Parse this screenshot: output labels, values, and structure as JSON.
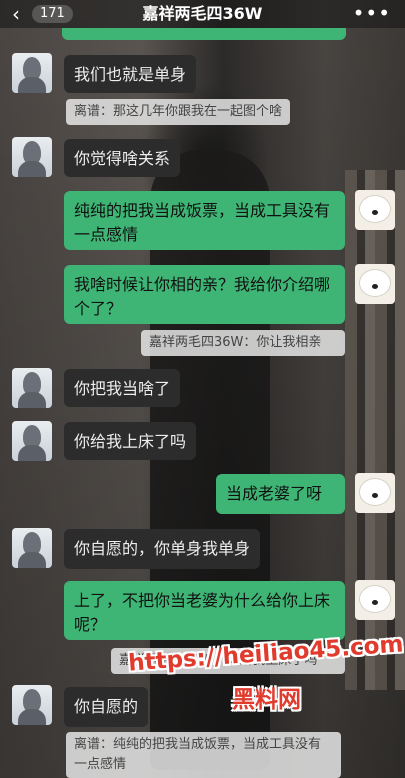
{
  "header": {
    "back_icon": "chevron-left-icon",
    "unread_count": "171",
    "title": "嘉祥两毛四36W",
    "more_icon": "more-dots-icon"
  },
  "colors": {
    "green_bubble": "#3eb575",
    "dark_bubble": "#2c2c2c",
    "quote_bg": "#e6e6e6",
    "watermark": "#e13b2e"
  },
  "messages": [
    {
      "side": "left",
      "text": "我们也就是单身",
      "quote": "离谱：那这几年你跟我在一起图个啥"
    },
    {
      "side": "left",
      "text": "你觉得啥关系"
    },
    {
      "side": "right",
      "text": "纯纯的把我当成饭票，当成工具没有一点感情"
    },
    {
      "side": "right",
      "text": "我啥时候让你相的亲？我给你介绍哪个了？",
      "quote": "嘉祥两毛四36W：你让我相亲"
    },
    {
      "side": "left",
      "text": "你把我当啥了"
    },
    {
      "side": "left",
      "text": "你给我上床了吗"
    },
    {
      "side": "right",
      "text": "当成老婆了呀"
    },
    {
      "side": "left",
      "text": "你自愿的，你单身我单身"
    },
    {
      "side": "right",
      "text": "上了，不把你当老婆为什么给你上床呢？",
      "quote": "嘉祥两毛四36W：你给我上床了吗"
    },
    {
      "side": "left",
      "text": "你自愿的",
      "quote": "离谱：纯纯的把我当成饭票，当成工具没有一点感情"
    }
  ],
  "watermark": {
    "url": "https://heiliao45.com",
    "name": "黑料网"
  }
}
